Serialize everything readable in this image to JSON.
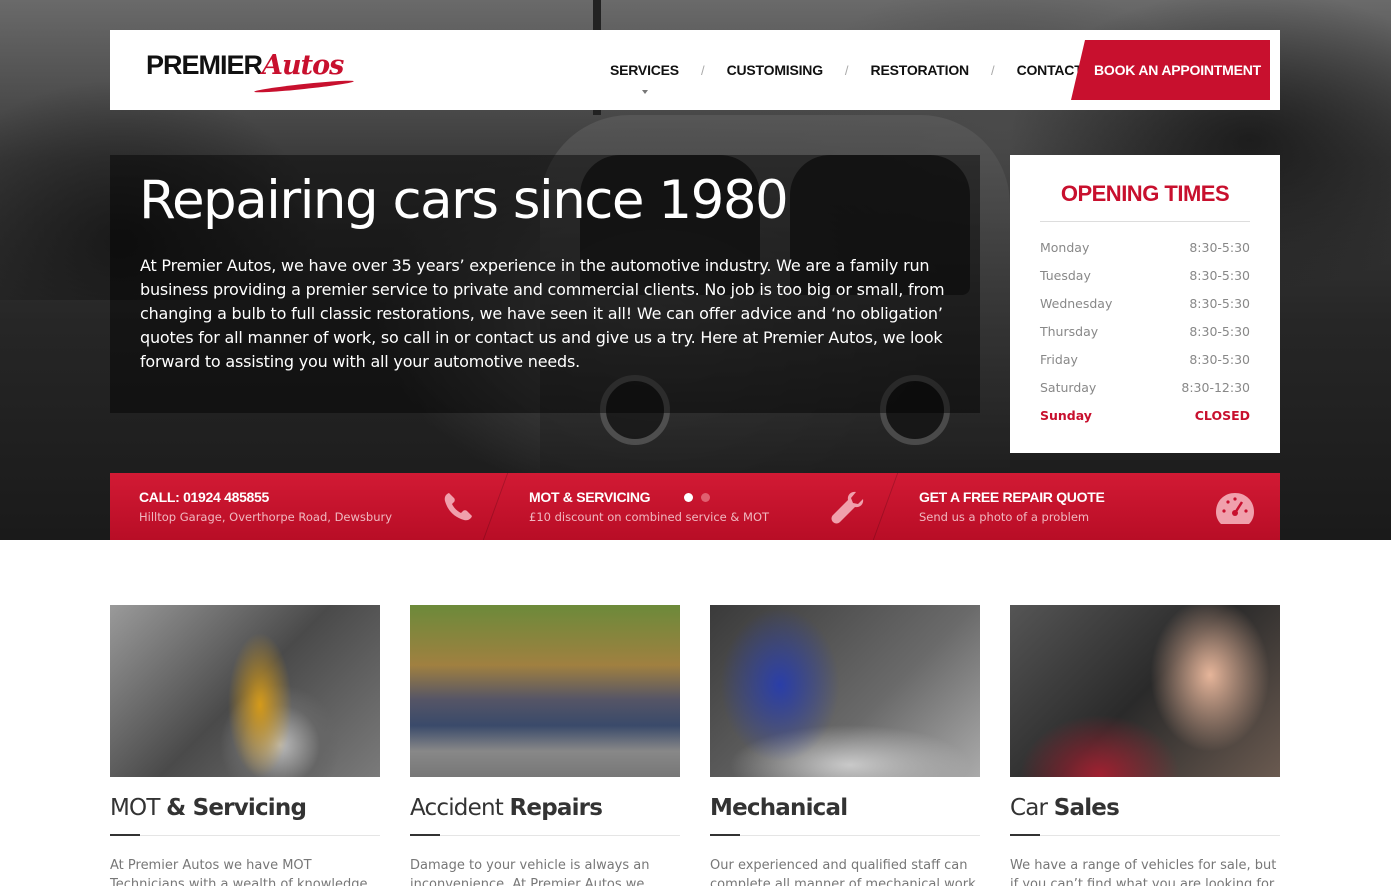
{
  "brand": {
    "name_part1": "PREMIER",
    "name_part2": "Autos"
  },
  "nav": {
    "items": [
      "SERVICES",
      "CUSTOMISING",
      "RESTORATION",
      "CONTACT"
    ],
    "separator": "/",
    "book_label": "BOOK AN APPOINTMENT"
  },
  "hero": {
    "title": "Repairing cars since 1980",
    "body": "At Premier Autos, we have over 35 years’ experience in the automotive industry. We are a family run business providing a premier service to private and commercial clients. No job is too big or small, from changing a bulb to full classic restorations, we have seen it all! We can offer advice and ‘no obligation’ quotes for all manner of work, so call in or contact us and give us a try. Here at Premier Autos, we look forward to assisting you with all your automotive needs."
  },
  "hours": {
    "title": "OPENING TIMES",
    "rows": [
      {
        "day": "Monday",
        "time": "8:30-5:30"
      },
      {
        "day": "Tuesday",
        "time": "8:30-5:30"
      },
      {
        "day": "Wednesday",
        "time": "8:30-5:30"
      },
      {
        "day": "Thursday",
        "time": "8:30-5:30"
      },
      {
        "day": "Friday",
        "time": "8:30-5:30"
      },
      {
        "day": "Saturday",
        "time": "8:30-12:30"
      },
      {
        "day": "Sunday",
        "time": "CLOSED"
      }
    ]
  },
  "infobar": {
    "call": {
      "title": "CALL: 01924 485855",
      "sub": "Hilltop Garage, Overthorpe Road, Dewsbury",
      "icon": "phone-icon"
    },
    "mot": {
      "title": "MOT & SERVICING",
      "sub": "£10 discount on combined service & MOT",
      "icon": "wrench-icon"
    },
    "quote": {
      "title": "GET A FREE REPAIR QUOTE",
      "sub": "Send us a photo of a problem",
      "icon": "gauge-icon"
    }
  },
  "cards": [
    {
      "light": "MOT",
      "bold": "& Servicing",
      "text": "At Premier Autos we have MOT Technicians with a wealth of knowledge and experience"
    },
    {
      "light": "Accident",
      "bold": "Repairs",
      "text": "Damage to your vehicle is always an inconvenience. At Premier Autos we have a"
    },
    {
      "light": "",
      "bold": "Mechanical",
      "text": "Our experienced and qualified staff can complete all manner of mechanical work"
    },
    {
      "light": "Car",
      "bold": "Sales",
      "text": "We have a range of vehicles for sale, but if you can’t find what you are looking for here"
    }
  ],
  "colors": {
    "brand_red": "#c8102e",
    "dark": "#111111",
    "muted": "#777777"
  }
}
